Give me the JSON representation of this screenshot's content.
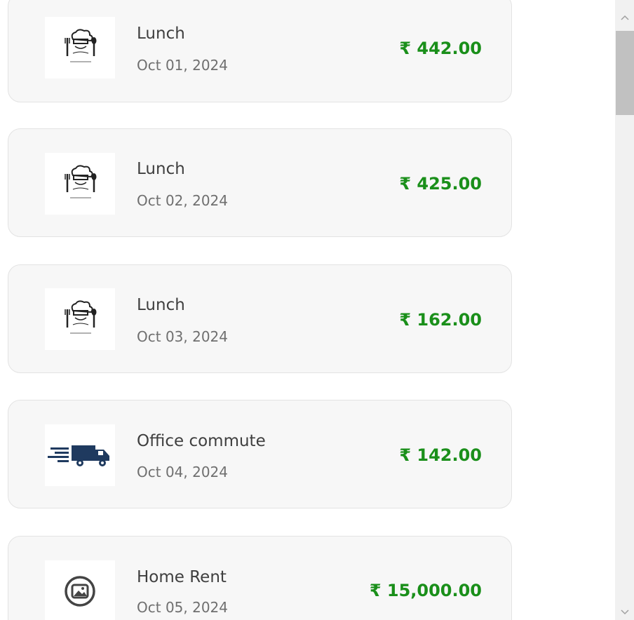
{
  "expenses": [
    {
      "title": "Lunch",
      "date": "Oct 01, 2024",
      "amount": "₹ 442.00",
      "icon": "chef-icon"
    },
    {
      "title": "Lunch",
      "date": "Oct 02, 2024",
      "amount": "₹ 425.00",
      "icon": "chef-icon"
    },
    {
      "title": "Lunch",
      "date": "Oct 03, 2024",
      "amount": "₹ 162.00",
      "icon": "chef-icon"
    },
    {
      "title": "Office commute",
      "date": "Oct 04, 2024",
      "amount": "₹ 142.00",
      "icon": "delivery-truck-icon"
    },
    {
      "title": "Home Rent",
      "date": "Oct 05, 2024",
      "amount": "₹ 15,000.00",
      "icon": "image-placeholder-icon"
    }
  ],
  "colors": {
    "amount": "#1a8f1a",
    "card_bg": "#f7f7f7",
    "truck": "#1f3a5f"
  },
  "scrollbar": {
    "up_icon": "chevron-up-icon",
    "down_icon": "chevron-down-icon"
  }
}
